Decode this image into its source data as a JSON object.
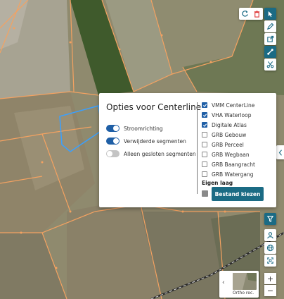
{
  "panel": {
    "title": "Opties voor Centerline",
    "toggles": [
      {
        "label": "Stroomrichting",
        "on": true
      },
      {
        "label": "Verwijderde segmenten",
        "on": true
      },
      {
        "label": "Alleen gesloten segmenten",
        "on": false
      }
    ],
    "layers": [
      {
        "label": "VMM CenterLine",
        "checked": true
      },
      {
        "label": "VHA Waterloop",
        "checked": true
      },
      {
        "label": "Digitale Atlas",
        "checked": true
      },
      {
        "label": "GRB Gebouw",
        "checked": false
      },
      {
        "label": "GRB Perceel",
        "checked": false
      },
      {
        "label": "GRB Wegbaan",
        "checked": false
      },
      {
        "label": "GRB Baangracht",
        "checked": false
      },
      {
        "label": "GRB Watergang",
        "checked": false
      }
    ],
    "own_layer_title": "Eigen laag",
    "choose_file_label": "Bestand kiezen"
  },
  "basemap": {
    "label": "Ortho rec.",
    "prev_icon": "chevron-left-icon"
  },
  "zoom": {
    "in_label": "+",
    "out_label": "−"
  },
  "toolbar": {
    "top_icons": [
      "refresh-icon",
      "trash-icon"
    ],
    "right_icons": [
      "select-arrow-icon",
      "pencil-icon",
      "external-edit-icon",
      "connect-icon",
      "scissors-icon",
      "filter-icon",
      "person-icon",
      "globe-icon",
      "fullscreen-icon"
    ]
  },
  "colors": {
    "accent": "#1b6b84",
    "toggle_on": "#1f5fa6",
    "parcel_outline": "#f4a261",
    "waterway": "#3aa0ff"
  }
}
